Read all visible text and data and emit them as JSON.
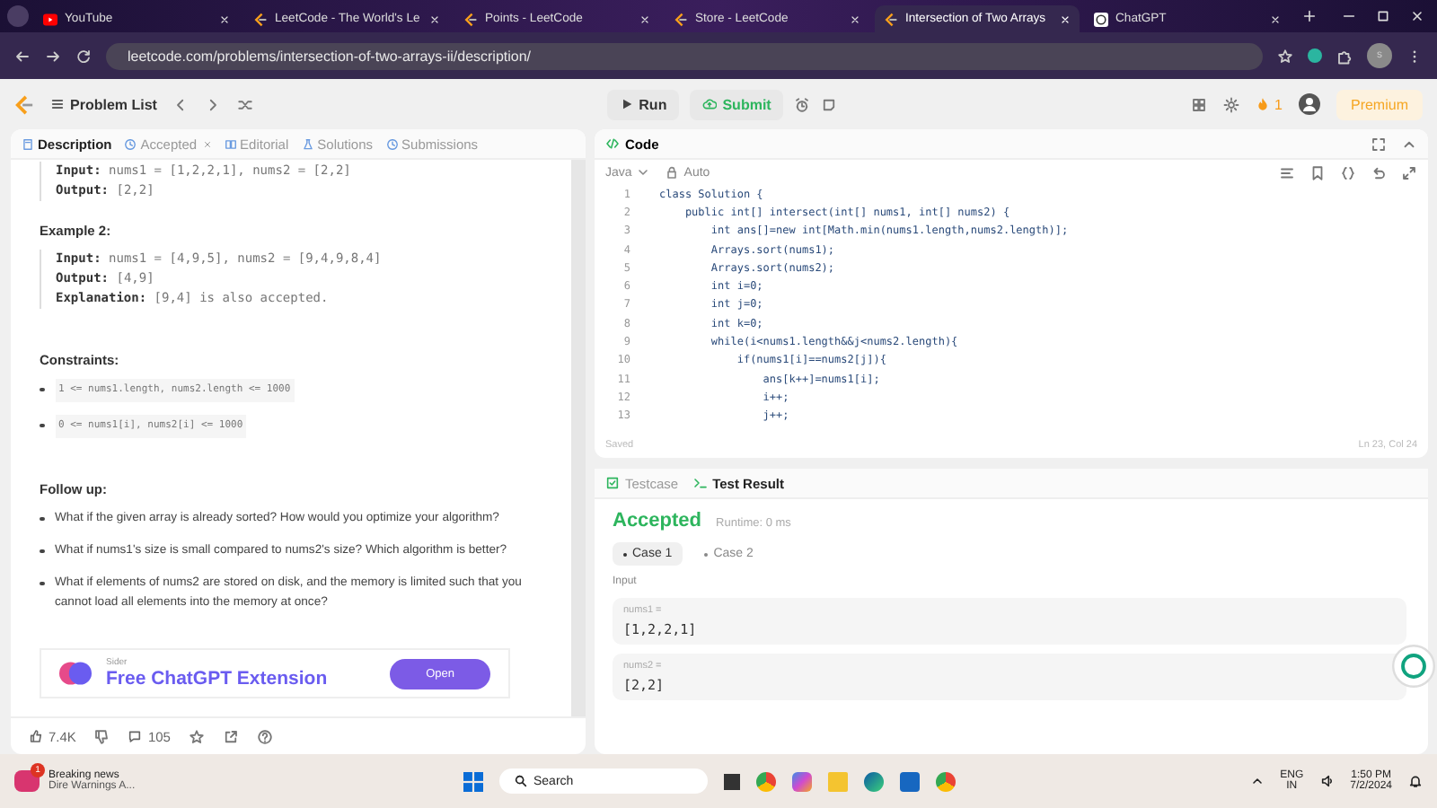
{
  "browser": {
    "tabs": [
      {
        "title": "YouTube",
        "selected": false,
        "kind": "youtube"
      },
      {
        "title": "LeetCode - The World's Le",
        "selected": false,
        "kind": "leetcode"
      },
      {
        "title": "Points - LeetCode",
        "selected": false,
        "kind": "leetcode"
      },
      {
        "title": "Store - LeetCode",
        "selected": false,
        "kind": "leetcode"
      },
      {
        "title": "Intersection of Two Arrays",
        "selected": true,
        "kind": "leetcode"
      },
      {
        "title": "ChatGPT",
        "selected": false,
        "kind": "chatgpt"
      }
    ],
    "url": "leetcode.com/problems/intersection-of-two-arrays-ii/description/",
    "profile": "s"
  },
  "topbar": {
    "problem_list": "Problem List",
    "run": "Run",
    "submit": "Submit",
    "streak": "1",
    "premium": "Premium"
  },
  "description": {
    "tabs": [
      {
        "label": "Description",
        "selected": true,
        "closable": false
      },
      {
        "label": "Accepted",
        "selected": false,
        "closable": true
      },
      {
        "label": "Editorial",
        "selected": false,
        "closable": false
      },
      {
        "label": "Solutions",
        "selected": false,
        "closable": false
      },
      {
        "label": "Submissions",
        "selected": false,
        "closable": false
      }
    ],
    "example1_lines": [
      "**Input:** nums1 = [1,2,2,1], nums2 = [2,2]",
      "**Output:** [2,2]"
    ],
    "example2_title": "Example 2:",
    "example2_lines": [
      "**Input:** nums1 = [4,9,5], nums2 = [9,4,9,8,4]",
      "**Output:** [4,9]",
      "**Explanation:** [9,4] is also accepted."
    ],
    "constraints_title": "Constraints:",
    "constraints": [
      "1 <= nums1.length, nums2.length <= 1000",
      "0 <= nums1[i], nums2[i] <= 1000"
    ],
    "followup_title": "Follow up:",
    "followup": [
      "What if the given array is already sorted? How would you optimize your algorithm?",
      "What if nums1's size is small compared to nums2's size? Which algorithm is better?",
      "What if elements of nums2 are stored on disk, and the memory is limited such that you cannot load all elements into the memory at once?"
    ],
    "ad": {
      "brand": "Sider",
      "title": "Free ChatGPT Extension",
      "button": "Open"
    },
    "likes": "7.4K",
    "comments": "105"
  },
  "code": {
    "title": "Code",
    "language": "Java",
    "mode": "Auto",
    "lines": [
      {
        "number": "1",
        "text": "class Solution {"
      },
      {
        "number": "2",
        "text": "    public int[] intersect(int[] nums1, int[] nums2) {"
      },
      {
        "number": "3",
        "text": "        int ans[]=new int[Math.min(nums1.length,nums2.length)];"
      },
      {
        "number": "4",
        "text": "        Arrays.sort(nums1);"
      },
      {
        "number": "5",
        "text": "        Arrays.sort(nums2);"
      },
      {
        "number": "6",
        "text": "        int i=0;"
      },
      {
        "number": "7",
        "text": "        int j=0;"
      },
      {
        "number": "8",
        "text": "        int k=0;"
      },
      {
        "number": "9",
        "text": "        while(i<nums1.length&&j<nums2.length){"
      },
      {
        "number": "10",
        "text": "            if(nums1[i]==nums2[j]){"
      },
      {
        "number": "11",
        "text": "                ans[k++]=nums1[i];"
      },
      {
        "number": "12",
        "text": "                i++;"
      },
      {
        "number": "13",
        "text": "                j++;"
      }
    ],
    "status": "Saved",
    "position": "Ln 23, Col 24"
  },
  "result": {
    "tabs": [
      {
        "label": "Testcase",
        "selected": false
      },
      {
        "label": "Test Result",
        "selected": true
      }
    ],
    "verdict": "Accepted",
    "runtime": "Runtime: 0 ms",
    "cases": [
      {
        "label": "Case 1",
        "selected": true
      },
      {
        "label": "Case 2",
        "selected": false
      }
    ],
    "input_label": "Input",
    "inputs": [
      {
        "name": "nums1 =",
        "value": "[1,2,2,1]"
      },
      {
        "name": "nums2 =",
        "value": "[2,2]"
      }
    ]
  },
  "taskbar": {
    "news_badge": "1",
    "news_title": "Breaking news",
    "news_text": "Dire Warnings A...",
    "search": "Search",
    "lang": "ENG",
    "region": "IN",
    "time": "1:50 PM",
    "date": "7/2/2024"
  }
}
